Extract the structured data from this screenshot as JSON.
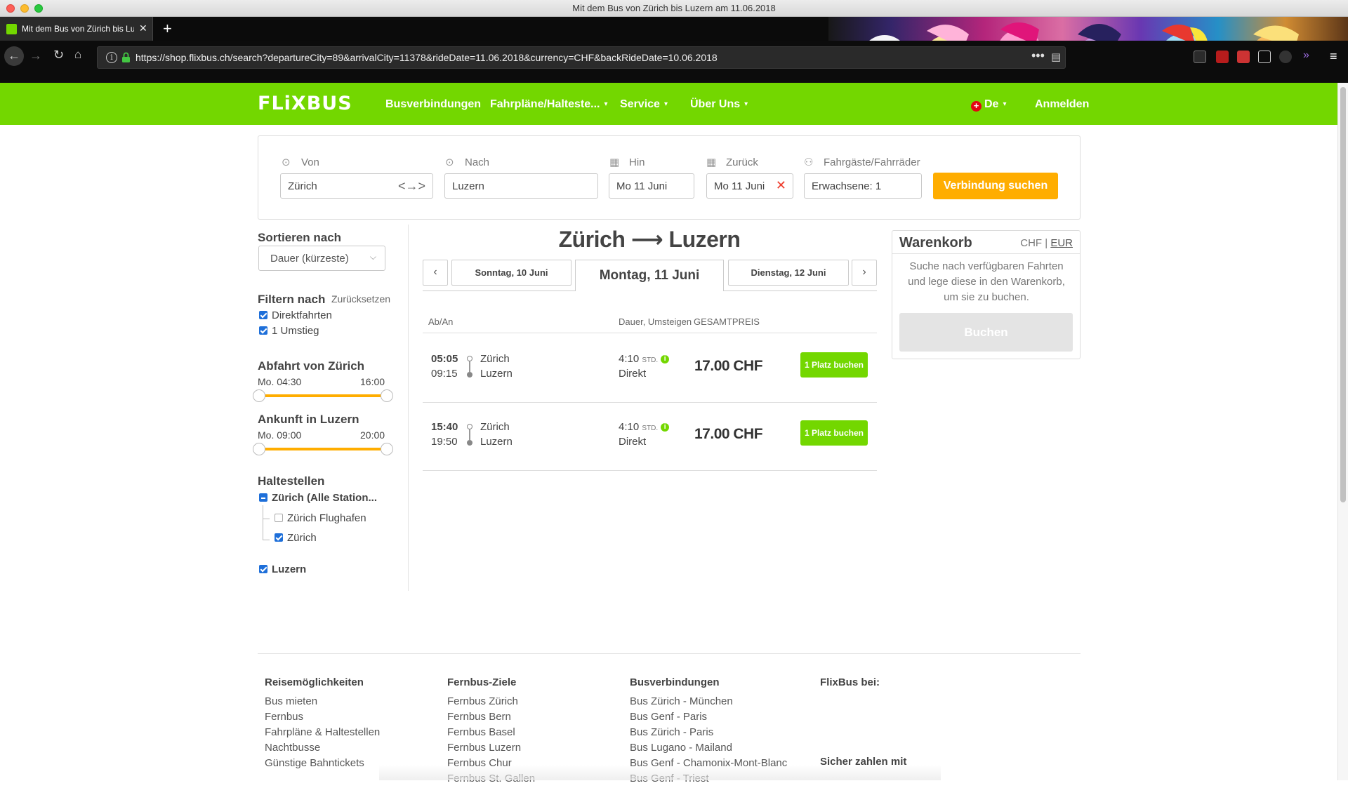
{
  "window": {
    "title": "Mit dem Bus von Zürich bis Luzern am 11.06.2018"
  },
  "browser": {
    "tab_title": "Mit dem Bus von Zürich bis Luz",
    "url": "https://shop.flixbus.ch/search?departureCity=89&arrivalCity=11378&rideDate=11.06.2018&currency=CHF&backRideDate=10.06.2018",
    "new_tab": "+",
    "url_more": "•••"
  },
  "header": {
    "logo": "FLiXBUS",
    "nav": [
      {
        "label": "Busverbindungen"
      },
      {
        "label": "Fahrpläne/Halteste..."
      },
      {
        "label": "Service"
      },
      {
        "label": "Über Uns"
      }
    ],
    "language": "De",
    "login": "Anmelden"
  },
  "search": {
    "from_label": "Von",
    "from_value": "Zürich",
    "to_label": "Nach",
    "to_value": "Luzern",
    "outbound_label": "Hin",
    "outbound_value": "Mo 11 Juni",
    "return_label": "Zurück",
    "return_value": "Mo 11 Juni",
    "passengers_label": "Fahrgäste/Fahrräder",
    "passengers_value": "Erwachsene: 1",
    "button": "Verbindung suchen"
  },
  "sidebar": {
    "sort_heading": "Sortieren nach",
    "sort_value": "Dauer (kürzeste)",
    "filter_heading": "Filtern nach",
    "reset": "Zurücksetzen",
    "filters": [
      {
        "label": "Direktfahrten",
        "checked": true
      },
      {
        "label": "1 Umstieg",
        "checked": true
      }
    ],
    "departure_heading": "Abfahrt von Zürich",
    "departure_min": "Mo. 04:30",
    "departure_max": "16:00",
    "arrival_heading": "Ankunft in Luzern",
    "arrival_min": "Mo. 09:00",
    "arrival_max": "20:00",
    "stops_heading": "Haltestellen",
    "stop_group": "Zürich (Alle Station...",
    "stops": [
      {
        "label": "Zürich Flughafen",
        "checked": false
      },
      {
        "label": "Zürich",
        "checked": true
      }
    ],
    "destination": "Luzern"
  },
  "results": {
    "route_title": "Zürich ⟶ Luzern",
    "prev_day": "Sonntag, 10 Juni",
    "current_day": "Montag, 11 Juni",
    "next_day": "Dienstag, 12 Juni",
    "col_time": "Ab/An",
    "col_duration": "Dauer, Umsteigen",
    "col_price": "GESAMTPREIS",
    "rides": [
      {
        "dep": "05:05",
        "arr": "09:15",
        "from": "Zürich",
        "to": "Luzern",
        "duration": "4:10",
        "unit": "STD.",
        "type": "Direkt",
        "price": "17.00 CHF",
        "book": "1 Platz buchen"
      },
      {
        "dep": "15:40",
        "arr": "19:50",
        "from": "Zürich",
        "to": "Luzern",
        "duration": "4:10",
        "unit": "STD.",
        "type": "Direkt",
        "price": "17.00 CHF",
        "book": "1 Platz buchen"
      }
    ]
  },
  "cart": {
    "title": "Warenkorb",
    "currency_chf": "CHF",
    "currency_eur": "EUR",
    "text": "Suche nach verfügbaren Fahrten und lege diese in den Warenkorb, um sie zu buchen.",
    "button": "Buchen"
  },
  "footer": {
    "columns": [
      {
        "heading": "Reisemöglichkeiten",
        "links": [
          "Bus mieten",
          "Fernbus",
          "Fahrpläne & Haltestellen",
          "Nachtbusse",
          "Günstige Bahntickets"
        ]
      },
      {
        "heading": "Fernbus-Ziele",
        "links": [
          "Fernbus Zürich",
          "Fernbus Bern",
          "Fernbus Basel",
          "Fernbus Luzern",
          "Fernbus Chur",
          "Fernbus St. Gallen"
        ]
      },
      {
        "heading": "Busverbindungen",
        "links": [
          "Bus Zürich - München",
          "Bus Genf - Paris",
          "Bus Zürich - Paris",
          "Bus Lugano - Mailand",
          "Bus Genf - Chamonix-Mont-Blanc",
          "Bus Genf - Triest"
        ]
      },
      {
        "heading": "FlixBus bei:",
        "links": []
      }
    ],
    "secure_pay": "Sicher zahlen mit"
  },
  "colors": {
    "brand_green": "#73d700",
    "accent_orange": "#ffad00",
    "checkbox_blue": "#1e6fd9"
  }
}
